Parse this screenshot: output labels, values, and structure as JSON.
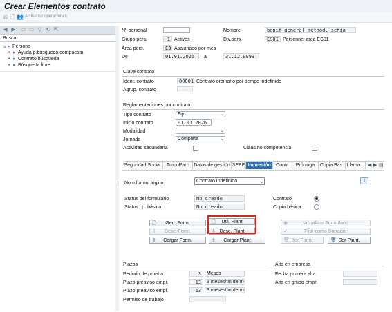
{
  "window": {
    "title": "Crear Elementos contrato"
  },
  "toolbar": {
    "actualizar_label": "Actualizar operaciones"
  },
  "left_panel": {
    "buscar_label": "Buscar",
    "tree": [
      {
        "label": "Persona",
        "level": 0
      },
      {
        "label": "Ayuda p.búsqueda compuesta",
        "level": 1
      },
      {
        "label": "Contrato búsqueda",
        "level": 1
      },
      {
        "label": "Búsqueda libre",
        "level": 1
      }
    ]
  },
  "header": {
    "nro_personal_label": "Nº personal",
    "nro_personal_value": "",
    "nombre_label": "Nombre",
    "nombre_value": "bonif general method, schia",
    "grupo_pers_label": "Grupo pers.",
    "grupo_pers_code": "1",
    "grupo_pers_text": "Activos",
    "div_pers_label": "Div.pers.",
    "div_pers_code": "ES01",
    "div_pers_text": "Personnel area ES01",
    "area_pers_label": "Área pers.",
    "area_pers_code": "E3",
    "area_pers_text": "Asalariado por mes",
    "de_label": "De",
    "de_value": "01.01.2026",
    "a_label": "a",
    "a_value": "31.12.9999"
  },
  "clave_contrato": {
    "title": "Clave contrato",
    "ident_label": "Ident. contrato",
    "ident_code": "00001",
    "ident_text": "Contrato ordinario por tiempo indefinido",
    "agrup_label": "Agrup. contrato",
    "agrup_value": ""
  },
  "reglamentaciones": {
    "title": "Reglamentaciones por contrato",
    "tipo_label": "Tipo contrato",
    "tipo_value": "Fijo",
    "inicio_label": "Inicio contrato",
    "inicio_value": "01.01.2026",
    "modalidad_label": "Modalidad",
    "modalidad_value": "",
    "jornada_label": "Jornada",
    "jornada_value": "Completa",
    "actividad_label": "Actividad secundaria",
    "actividad_checked": false,
    "clausula_label": "Cláus.no competencia",
    "clausula_checked": false
  },
  "tabs": [
    {
      "label": "Seguridad Social",
      "active": false
    },
    {
      "label": "TmpoParc",
      "active": false
    },
    {
      "label": "Datos de gestión",
      "active": false
    },
    {
      "label": "SEPE",
      "active": false
    },
    {
      "label": "Impresión",
      "active": true
    },
    {
      "label": "Contr.",
      "active": false
    },
    {
      "label": "Prórroga",
      "active": false
    },
    {
      "label": "Copia Bás.",
      "active": false
    },
    {
      "label": "Llama...",
      "active": false
    }
  ],
  "impresion": {
    "nom_formul_label": "Nom.formul.lógico",
    "nom_formul_value": "Contrato Indefinido",
    "status_formulario_label": "Status del formulario",
    "status_formulario_value": "No creado",
    "status_cp_label": "Status cp. básica",
    "status_cp_value": "No creado",
    "contrato_label": "Contrato",
    "contrato_selected": true,
    "copia_basica_label": "Copia básica",
    "copia_basica_selected": false,
    "buttons": {
      "gen_form": "Gen. Form.",
      "util_plant": "Util. Plant",
      "visualizar_formulario": "Visualizar Formulario",
      "desc_form": "Desc. Form.",
      "desc_plant": "Desc. Plant",
      "fijar_como_borrador": "Fijar como Borrador",
      "cargar_form": "Cargar Form.",
      "cargar_plant": "Cargar Plant",
      "bor_form": "Bor Form.",
      "bor_plant": "Bor Plant."
    }
  },
  "plazos": {
    "title": "Plazos",
    "periodo_label": "Período de prueba",
    "periodo_value": "3",
    "periodo_unit": "Meses",
    "preaviso_empr_label": "Plazo preaviso empr.",
    "preaviso_empr_value": "13",
    "preaviso_empr_unit": "3 meses/fin de mes",
    "preaviso_empl_label": "Plazo preaviso empl.",
    "preaviso_empl_value": "13",
    "preaviso_empl_unit": "3 meses/fin de mes",
    "permiso_label": "Permiso de trabajo",
    "permiso_value": ""
  },
  "alta": {
    "title": "Alta en empresa",
    "fecha_label": "Fecha primera alta",
    "fecha_value": "",
    "grupo_label": "Alta en grupo empr.",
    "grupo_value": ""
  },
  "colors": {
    "highlight": "#d9261c",
    "active_tab": "#2f6fb6"
  }
}
